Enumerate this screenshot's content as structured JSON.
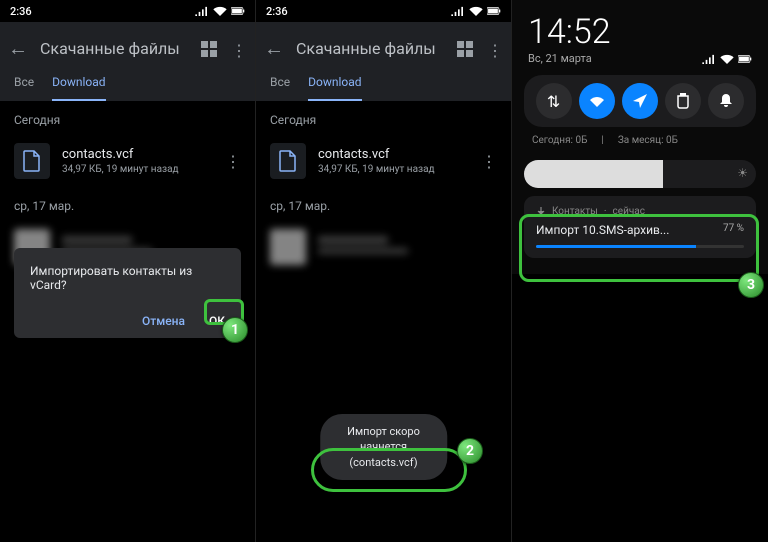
{
  "statusbar": {
    "time": "2:36",
    "bt": "✱"
  },
  "appbar": {
    "title": "Скачанные файлы"
  },
  "tabs": {
    "all": "Все",
    "download": "Download"
  },
  "sections": {
    "today": "Сегодня",
    "older": "ср, 17 мар."
  },
  "file": {
    "name": "contacts.vcf",
    "meta": "34,97 КБ, 19 минут назад"
  },
  "dialog": {
    "title": "Импортировать контакты из vCard?",
    "cancel": "Отмена",
    "ok": "ОК"
  },
  "toast": {
    "line1": "Импорт скоро начнется",
    "line2": "(contacts.vcf)"
  },
  "shade": {
    "clock": "14:52",
    "date": "Вс, 21 марта",
    "usage1": "Сегодня: 0Б",
    "usage2": "За месяц: 0Б"
  },
  "notif": {
    "app": "Контакты",
    "when": "сейчас",
    "title": "Импорт 10.SMS-архив...",
    "pct": "77 %",
    "progress": 77
  },
  "badges": {
    "b1": "1",
    "b2": "2",
    "b3": "3"
  }
}
